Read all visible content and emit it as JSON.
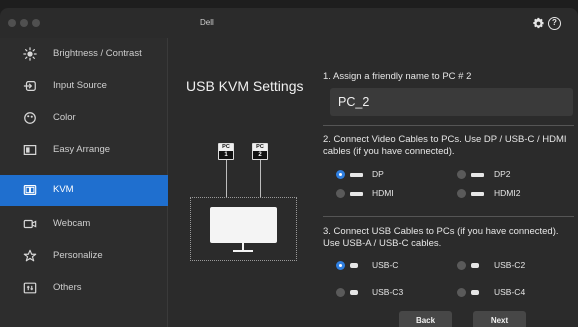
{
  "app": {
    "title": "Dell"
  },
  "sidebar": {
    "items": [
      {
        "label": "Brightness / Contrast",
        "icon": "brightness-icon"
      },
      {
        "label": "Input Source",
        "icon": "input-source-icon"
      },
      {
        "label": "Color",
        "icon": "color-icon"
      },
      {
        "label": "Easy Arrange",
        "icon": "easy-arrange-icon"
      },
      {
        "label": "KVM",
        "icon": "kvm-icon",
        "active": true
      },
      {
        "label": "Webcam",
        "icon": "webcam-icon"
      },
      {
        "label": "Personalize",
        "icon": "star-icon"
      },
      {
        "label": "Others",
        "icon": "others-icon"
      }
    ]
  },
  "main": {
    "title": "USB KVM Settings",
    "diagram": {
      "pc1_top": "PC",
      "pc1_num": "1",
      "pc2_top": "PC",
      "pc2_num": "2"
    },
    "step1": {
      "label": "1. Assign a friendly name to PC # 2",
      "value": "PC_2"
    },
    "step2": {
      "label": "2. Connect Video Cables to PCs. Use DP / USB-C / HDMI cables (if you have connected).",
      "options": [
        {
          "label": "DP",
          "selected": true
        },
        {
          "label": "DP2",
          "selected": false
        },
        {
          "label": "HDMI",
          "selected": false
        },
        {
          "label": "HDMI2",
          "selected": false
        }
      ]
    },
    "step3": {
      "label": "3. Connect USB Cables to PCs (if you have connected). Use USB-A / USB-C cables.",
      "options": [
        {
          "label": "USB-C",
          "selected": true
        },
        {
          "label": "USB-C2",
          "selected": false
        },
        {
          "label": "USB-C3",
          "selected": false
        },
        {
          "label": "USB-C4",
          "selected": false
        }
      ]
    },
    "buttons": {
      "back": "Back",
      "next": "Next"
    }
  },
  "colors": {
    "accent": "#1f6fcf",
    "background": "#2b2b2b",
    "radio_on": "#2f7fe0"
  }
}
